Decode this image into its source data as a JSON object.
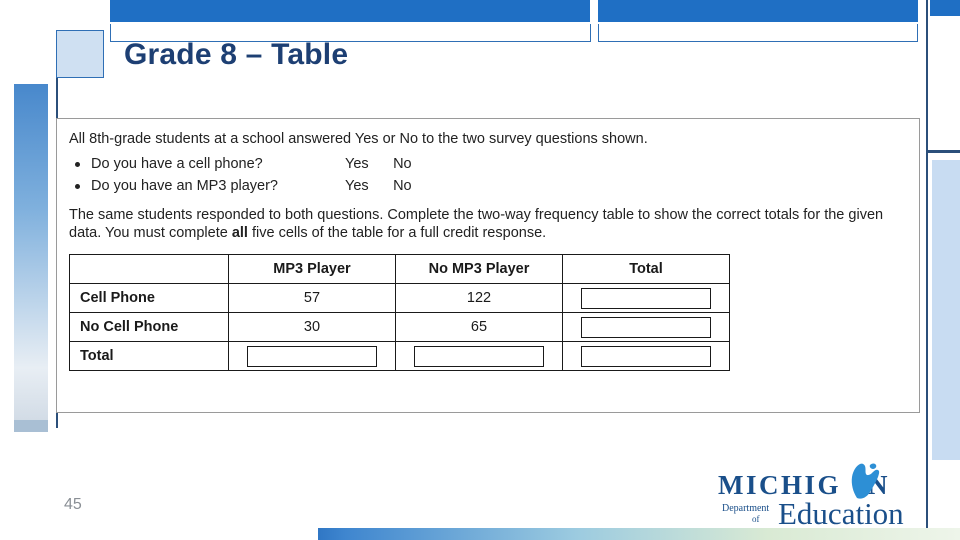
{
  "slide": {
    "title": "Grade 8 – Table",
    "page_number": "45"
  },
  "question": {
    "intro": "All 8th-grade students at a school answered Yes or No to the two survey questions shown.",
    "items": [
      {
        "text": "Do you have a cell phone?",
        "option1": "Yes",
        "option2": "No"
      },
      {
        "text": "Do you have an MP3 player?",
        "option1": "Yes",
        "option2": "No"
      }
    ],
    "instructions_part1": "The same students responded to both questions. Complete the two-way frequency table to show the correct totals for the given data. You must complete ",
    "instructions_emphasis": "all",
    "instructions_part2": " five cells of the table for a full credit response."
  },
  "table": {
    "corner_label": "",
    "column_headers": [
      "MP3 Player",
      "No MP3 Player",
      "Total"
    ],
    "rows": [
      {
        "label": "Cell Phone",
        "cells": [
          "57",
          "122",
          ""
        ]
      },
      {
        "label": "No Cell Phone",
        "cells": [
          "30",
          "65",
          ""
        ]
      },
      {
        "label": "Total",
        "cells": [
          "",
          "",
          ""
        ]
      }
    ]
  },
  "logo": {
    "michigan": "MICHIG",
    "michigan_tail": "N",
    "department": "Department",
    "of": "of",
    "education": "Education"
  },
  "colors": {
    "accent_blue": "#1f6fc4",
    "title_blue": "#1d3f73",
    "logo_blue": "#1a4f8a"
  }
}
